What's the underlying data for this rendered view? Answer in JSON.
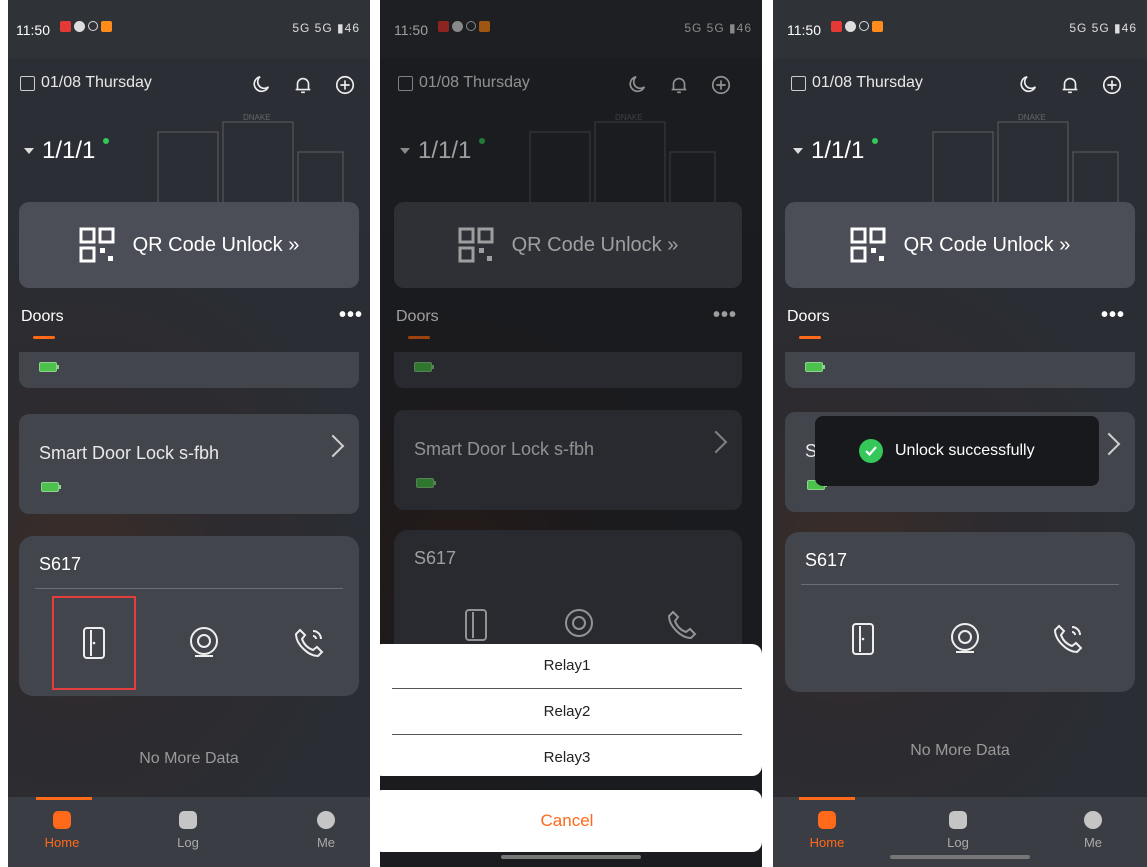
{
  "status": {
    "time": "11:50",
    "signal": "5G 5G",
    "battery": "46"
  },
  "header": {
    "date": "01/08 Thursday",
    "unit": "1/1/1",
    "building_brand": "DNAKE"
  },
  "qr": {
    "label": "QR Code Unlock »"
  },
  "doors": {
    "title": "Doors",
    "more": "•••"
  },
  "lock_card": {
    "title": "Smart Door Lock s-fbh"
  },
  "device": {
    "name": "S617",
    "actions": [
      "unlock",
      "monitor",
      "call"
    ]
  },
  "footer": {
    "no_more": "No More Data"
  },
  "tabs": [
    {
      "label": "Home",
      "active": true
    },
    {
      "label": "Log",
      "active": false
    },
    {
      "label": "Me",
      "active": false
    }
  ],
  "sheet": {
    "items": [
      "Relay1",
      "Relay2",
      "Relay3"
    ],
    "cancel": "Cancel"
  },
  "toast": {
    "text": "Unlock successfully"
  },
  "colors": {
    "accent": "#ff6a1a",
    "background": "#2b2e34",
    "card": "#42454c",
    "success": "#35c759",
    "highlight": "#e33d3d"
  },
  "icons": {
    "calendar": "calendar-icon",
    "moon": "moon-icon",
    "bell": "bell-icon",
    "add": "add-circle-icon",
    "qr": "qr-code-icon",
    "door": "door-icon",
    "camera": "camera-icon",
    "phone": "phone-call-icon",
    "home": "home-icon",
    "log": "log-icon",
    "me": "user-icon"
  }
}
